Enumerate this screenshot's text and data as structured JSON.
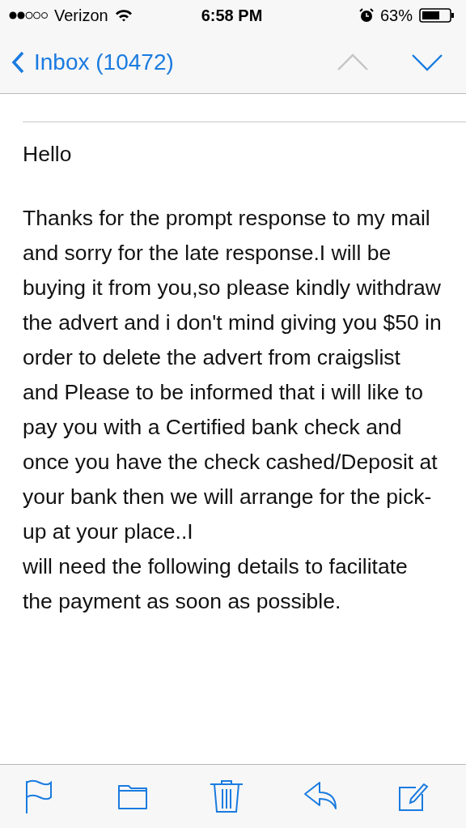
{
  "status_bar": {
    "carrier": "Verizon",
    "time": "6:58 PM",
    "battery": "63%"
  },
  "nav": {
    "back_label": "Inbox (10472)",
    "previous": {
      "disabled": true
    },
    "next": {
      "disabled": false
    }
  },
  "message": {
    "paragraphs": [
      "Hello",
      "Thanks for the prompt response to my mail and sorry for the late response.I will be buying it from you,so please kindly withdraw the advert and i don't mind giving you $50 in order to delete the advert from craigslist and  Please to be informed that i will like to pay you with a Certified bank check and once you have the check cashed/Deposit at your bank then we will arrange for the pick-up at your place..I\nwill need the following details to facilitate the payment as soon as possible."
    ]
  },
  "toolbar": [
    {
      "kind": "flag"
    },
    {
      "kind": "folder"
    },
    {
      "kind": "trash"
    },
    {
      "kind": "reply"
    },
    {
      "kind": "compose"
    }
  ]
}
